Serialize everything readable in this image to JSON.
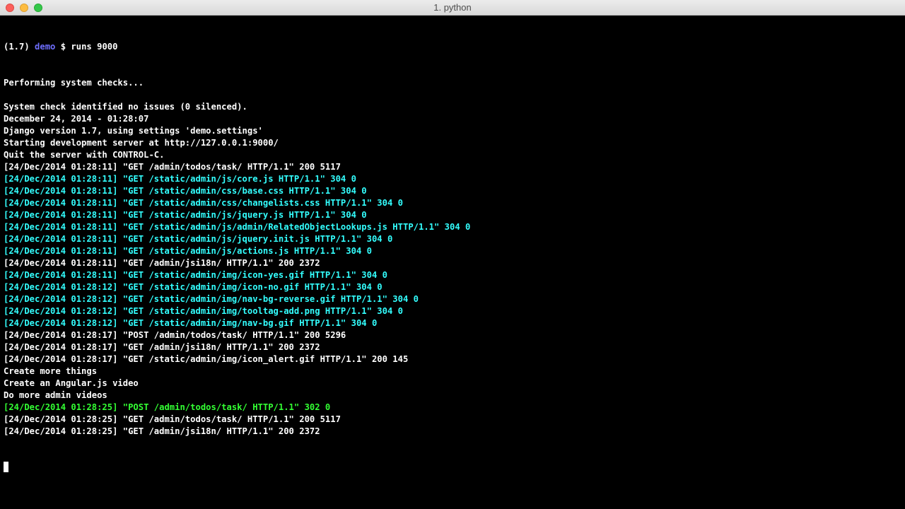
{
  "window": {
    "title": "1. python"
  },
  "colors": {
    "default": "#ffffff",
    "static": "#33ffff",
    "post_redirect": "#33ff33",
    "prompt_dir": "#6f6fff"
  },
  "prompt": {
    "env": "(1.7)",
    "dir": "demo",
    "symbol": "$",
    "command": "runs 9000"
  },
  "lines": [
    {
      "text": "Performing system checks...",
      "color": "white"
    },
    {
      "text": "",
      "color": "white"
    },
    {
      "text": "System check identified no issues (0 silenced).",
      "color": "white"
    },
    {
      "text": "December 24, 2014 - 01:28:07",
      "color": "white"
    },
    {
      "text": "Django version 1.7, using settings 'demo.settings'",
      "color": "white"
    },
    {
      "text": "Starting development server at http://127.0.0.1:9000/",
      "color": "white"
    },
    {
      "text": "Quit the server with CONTROL-C.",
      "color": "white"
    },
    {
      "text": "[24/Dec/2014 01:28:11] \"GET /admin/todos/task/ HTTP/1.1\" 200 5117",
      "color": "white"
    },
    {
      "text": "[24/Dec/2014 01:28:11] \"GET /static/admin/js/core.js HTTP/1.1\" 304 0",
      "color": "cyan"
    },
    {
      "text": "[24/Dec/2014 01:28:11] \"GET /static/admin/css/base.css HTTP/1.1\" 304 0",
      "color": "cyan"
    },
    {
      "text": "[24/Dec/2014 01:28:11] \"GET /static/admin/css/changelists.css HTTP/1.1\" 304 0",
      "color": "cyan"
    },
    {
      "text": "[24/Dec/2014 01:28:11] \"GET /static/admin/js/jquery.js HTTP/1.1\" 304 0",
      "color": "cyan"
    },
    {
      "text": "[24/Dec/2014 01:28:11] \"GET /static/admin/js/admin/RelatedObjectLookups.js HTTP/1.1\" 304 0",
      "color": "cyan"
    },
    {
      "text": "[24/Dec/2014 01:28:11] \"GET /static/admin/js/jquery.init.js HTTP/1.1\" 304 0",
      "color": "cyan"
    },
    {
      "text": "[24/Dec/2014 01:28:11] \"GET /static/admin/js/actions.js HTTP/1.1\" 304 0",
      "color": "cyan"
    },
    {
      "text": "[24/Dec/2014 01:28:11] \"GET /admin/jsi18n/ HTTP/1.1\" 200 2372",
      "color": "white"
    },
    {
      "text": "[24/Dec/2014 01:28:11] \"GET /static/admin/img/icon-yes.gif HTTP/1.1\" 304 0",
      "color": "cyan"
    },
    {
      "text": "[24/Dec/2014 01:28:12] \"GET /static/admin/img/icon-no.gif HTTP/1.1\" 304 0",
      "color": "cyan"
    },
    {
      "text": "[24/Dec/2014 01:28:12] \"GET /static/admin/img/nav-bg-reverse.gif HTTP/1.1\" 304 0",
      "color": "cyan"
    },
    {
      "text": "[24/Dec/2014 01:28:12] \"GET /static/admin/img/tooltag-add.png HTTP/1.1\" 304 0",
      "color": "cyan"
    },
    {
      "text": "[24/Dec/2014 01:28:12] \"GET /static/admin/img/nav-bg.gif HTTP/1.1\" 304 0",
      "color": "cyan"
    },
    {
      "text": "[24/Dec/2014 01:28:17] \"POST /admin/todos/task/ HTTP/1.1\" 200 5296",
      "color": "white"
    },
    {
      "text": "[24/Dec/2014 01:28:17] \"GET /admin/jsi18n/ HTTP/1.1\" 200 2372",
      "color": "white"
    },
    {
      "text": "[24/Dec/2014 01:28:17] \"GET /static/admin/img/icon_alert.gif HTTP/1.1\" 200 145",
      "color": "white"
    },
    {
      "text": "Create more things",
      "color": "white"
    },
    {
      "text": "Create an Angular.js video",
      "color": "white"
    },
    {
      "text": "Do more admin videos",
      "color": "white"
    },
    {
      "text": "[24/Dec/2014 01:28:25] \"POST /admin/todos/task/ HTTP/1.1\" 302 0",
      "color": "green"
    },
    {
      "text": "[24/Dec/2014 01:28:25] \"GET /admin/todos/task/ HTTP/1.1\" 200 5117",
      "color": "white"
    },
    {
      "text": "[24/Dec/2014 01:28:25] \"GET /admin/jsi18n/ HTTP/1.1\" 200 2372",
      "color": "white"
    }
  ]
}
